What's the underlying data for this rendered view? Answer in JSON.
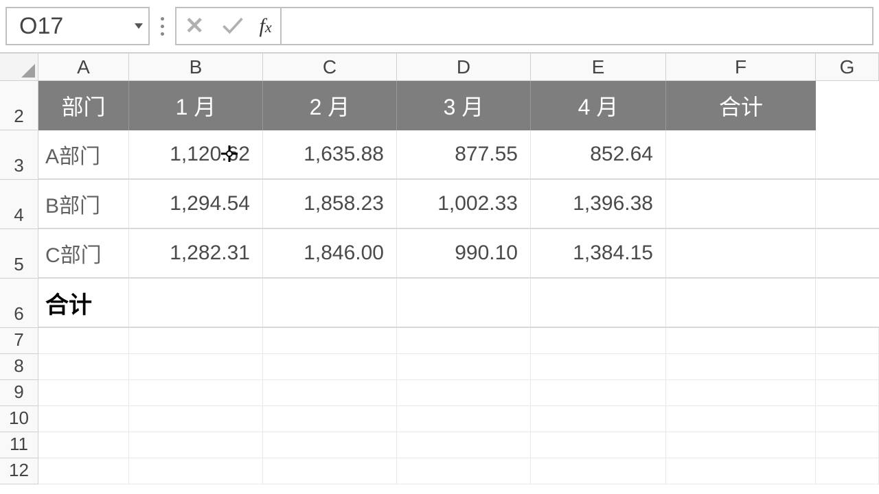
{
  "name_box": "O17",
  "formula": "",
  "columns": [
    "A",
    "B",
    "C",
    "D",
    "E",
    "F",
    "G"
  ],
  "empty_rows": [
    "7",
    "8",
    "9",
    "10",
    "11",
    "12"
  ],
  "header_row": {
    "num": "2",
    "cells": [
      "部门",
      "1 月",
      "2 月",
      "3 月",
      "4 月",
      "合计"
    ]
  },
  "data_rows": [
    {
      "num": "3",
      "label": "A部门",
      "vals": [
        "1,120.62",
        "1,635.88",
        "877.55",
        "852.64"
      ],
      "total": ""
    },
    {
      "num": "4",
      "label": "B部门",
      "vals": [
        "1,294.54",
        "1,858.23",
        "1,002.33",
        "1,396.38"
      ],
      "total": ""
    },
    {
      "num": "5",
      "label": "C部门",
      "vals": [
        "1,282.31",
        "1,846.00",
        "990.10",
        "1,384.15"
      ],
      "total": ""
    }
  ],
  "total_row": {
    "num": "6",
    "label": "合计"
  },
  "chart_data": {
    "type": "table",
    "columns": [
      "部门",
      "1 月",
      "2 月",
      "3 月",
      "4 月",
      "合计"
    ],
    "rows": [
      [
        "A部门",
        1120.62,
        1635.88,
        877.55,
        852.64,
        null
      ],
      [
        "B部门",
        1294.54,
        1858.23,
        1002.33,
        1396.38,
        null
      ],
      [
        "C部门",
        1282.31,
        1846.0,
        990.1,
        1384.15,
        null
      ],
      [
        "合计",
        null,
        null,
        null,
        null,
        null
      ]
    ]
  }
}
